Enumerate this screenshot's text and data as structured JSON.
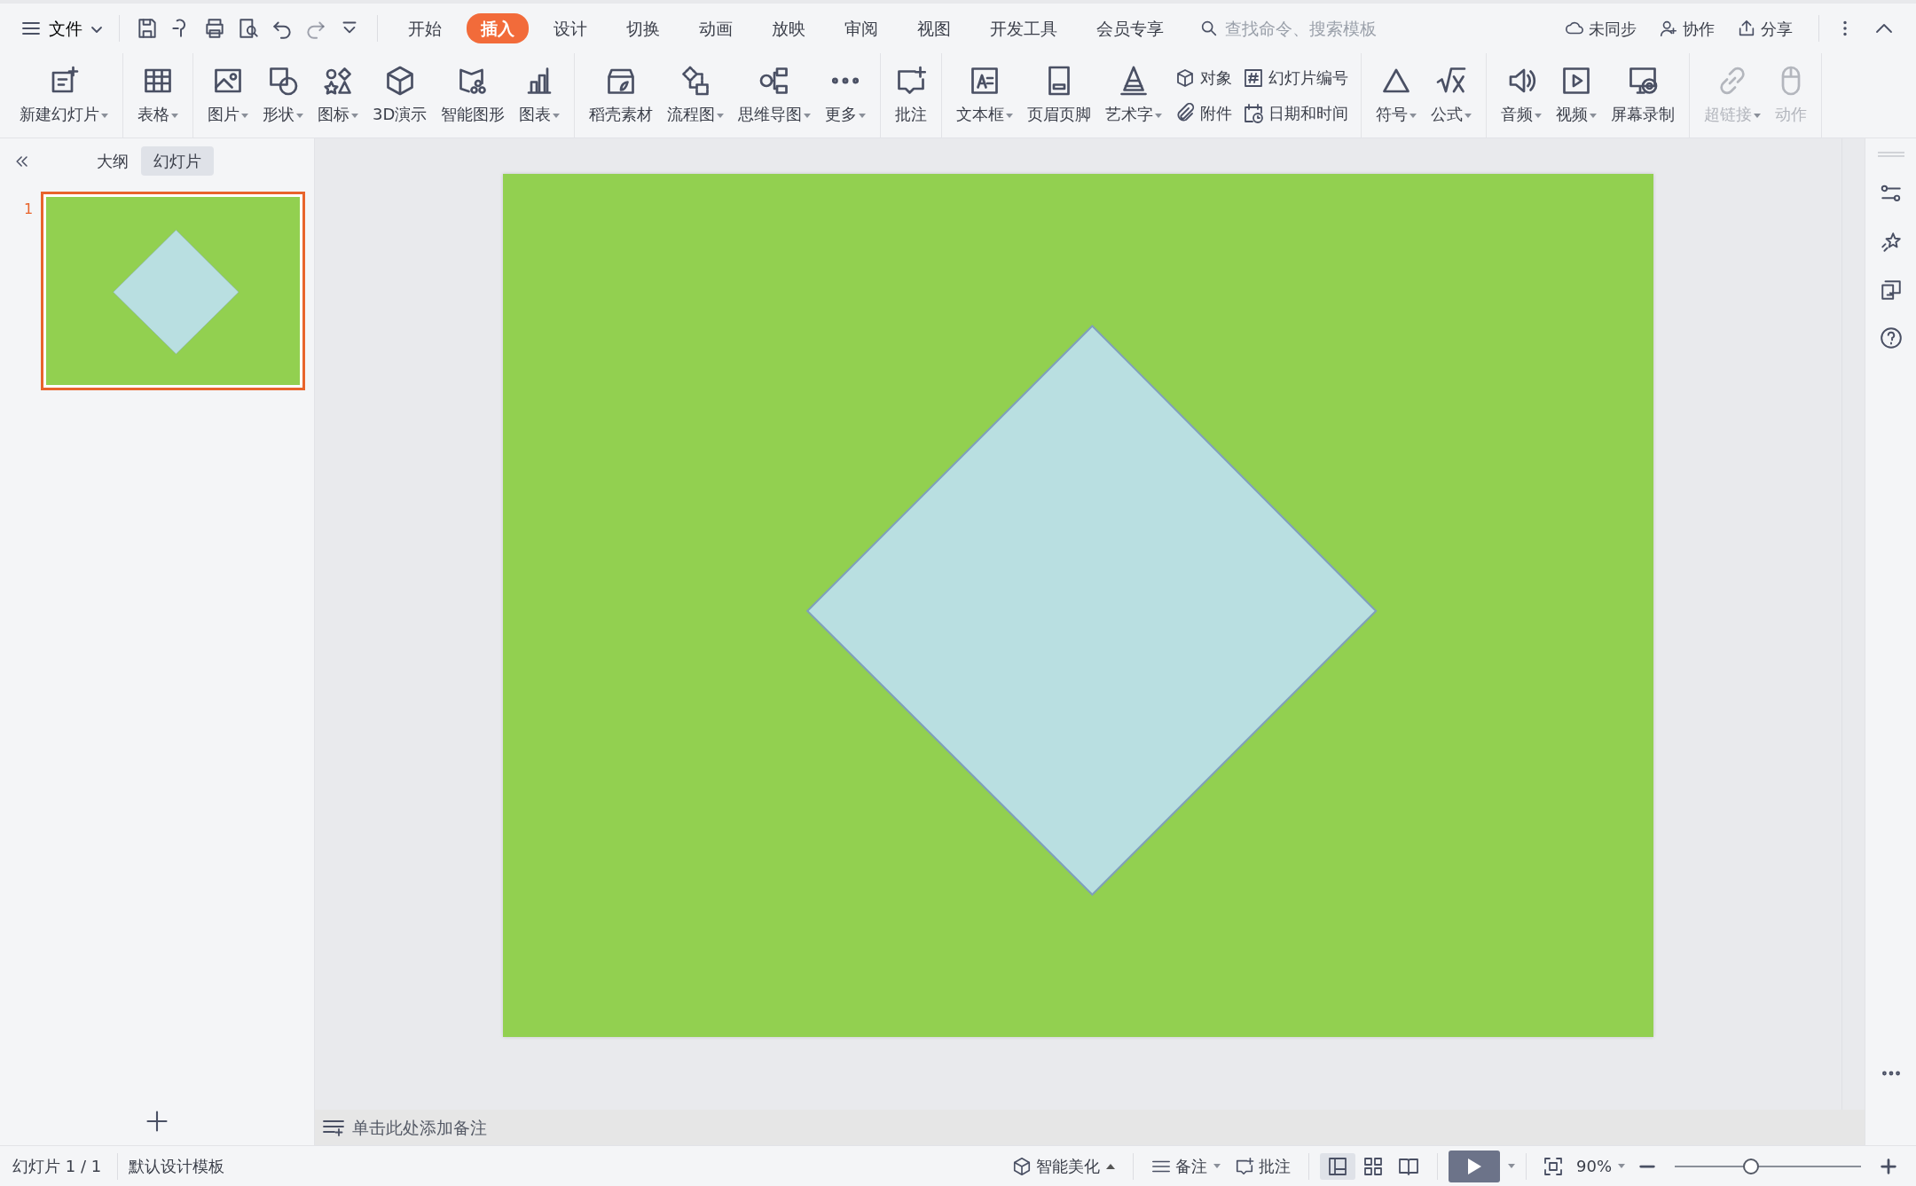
{
  "title_bar": {
    "file_menu": "文件",
    "tabs": [
      {
        "label": "开始",
        "selected": false
      },
      {
        "label": "插入",
        "selected": true
      },
      {
        "label": "设计",
        "selected": false
      },
      {
        "label": "切换",
        "selected": false
      },
      {
        "label": "动画",
        "selected": false
      },
      {
        "label": "放映",
        "selected": false
      },
      {
        "label": "审阅",
        "selected": false
      },
      {
        "label": "视图",
        "selected": false
      },
      {
        "label": "开发工具",
        "selected": false
      },
      {
        "label": "会员专享",
        "selected": false
      }
    ],
    "search": {
      "placeholder": "查找命令、搜索模板"
    },
    "actions": [
      "未同步",
      "协作",
      "分享"
    ]
  },
  "ribbon": [
    [
      {
        "kind": "large",
        "label": "新建幻灯片",
        "dropdown": true,
        "disabled": false
      }
    ],
    [
      {
        "kind": "large",
        "label": "表格",
        "dropdown": true,
        "disabled": false
      }
    ],
    [
      {
        "kind": "large",
        "label": "图片",
        "dropdown": true,
        "disabled": false
      },
      {
        "kind": "large",
        "label": "形状",
        "dropdown": true,
        "disabled": false
      },
      {
        "kind": "large",
        "label": "图标",
        "dropdown": true,
        "disabled": false
      },
      {
        "kind": "large",
        "label": "3D演示",
        "dropdown": false,
        "disabled": false
      },
      {
        "kind": "large",
        "label": "智能图形",
        "dropdown": false,
        "disabled": false
      },
      {
        "kind": "large",
        "label": "图表",
        "dropdown": true,
        "disabled": false
      }
    ],
    [
      {
        "kind": "large",
        "label": "稻壳素材",
        "dropdown": false,
        "disabled": false
      },
      {
        "kind": "large",
        "label": "流程图",
        "dropdown": true,
        "disabled": false
      },
      {
        "kind": "large",
        "label": "思维导图",
        "dropdown": true,
        "disabled": false
      },
      {
        "kind": "large",
        "label": "更多",
        "dropdown": true,
        "disabled": false
      }
    ],
    [
      {
        "kind": "large",
        "label": "批注",
        "dropdown": false,
        "disabled": false
      }
    ],
    [
      {
        "kind": "large",
        "label": "文本框",
        "dropdown": true,
        "disabled": false
      },
      {
        "kind": "large",
        "label": "页眉页脚",
        "dropdown": false,
        "disabled": false
      },
      {
        "kind": "large",
        "label": "艺术字",
        "dropdown": true,
        "disabled": false
      },
      {
        "kind": "small",
        "label": "对象",
        "dropdown": false,
        "disabled": false
      },
      {
        "kind": "small",
        "label": "附件",
        "dropdown": false,
        "disabled": false
      },
      {
        "kind": "small",
        "label": "幻灯片编号",
        "dropdown": false,
        "disabled": false
      },
      {
        "kind": "small",
        "label": "日期和时间",
        "dropdown": false,
        "disabled": false
      }
    ],
    [
      {
        "kind": "large",
        "label": "符号",
        "dropdown": true,
        "disabled": false
      },
      {
        "kind": "large",
        "label": "公式",
        "dropdown": true,
        "disabled": false
      }
    ],
    [
      {
        "kind": "large",
        "label": "音频",
        "dropdown": true,
        "disabled": false
      },
      {
        "kind": "large",
        "label": "视频",
        "dropdown": true,
        "disabled": false
      },
      {
        "kind": "large",
        "label": "屏幕录制",
        "dropdown": false,
        "disabled": false
      }
    ],
    [
      {
        "kind": "large",
        "label": "超链接",
        "dropdown": true,
        "disabled": true
      },
      {
        "kind": "large",
        "label": "动作",
        "dropdown": false,
        "disabled": true
      }
    ]
  ],
  "panel": {
    "tabs": [
      {
        "label": "大纲",
        "selected": false
      },
      {
        "label": "幻灯片",
        "selected": true
      }
    ],
    "slides": [
      {
        "number": "1",
        "selected": true
      }
    ]
  },
  "notes": {
    "placeholder": "单击此处添加备注"
  },
  "status_bar": {
    "slide": "幻灯片 1 / 1",
    "template": "默认设计模板",
    "beautify": "智能美化",
    "notes": "备注",
    "comments": "批注",
    "views": [
      {
        "selected": true
      },
      {
        "selected": false
      },
      {
        "selected": false
      }
    ],
    "zoom": {
      "value": "90%",
      "level": 0.41
    }
  }
}
